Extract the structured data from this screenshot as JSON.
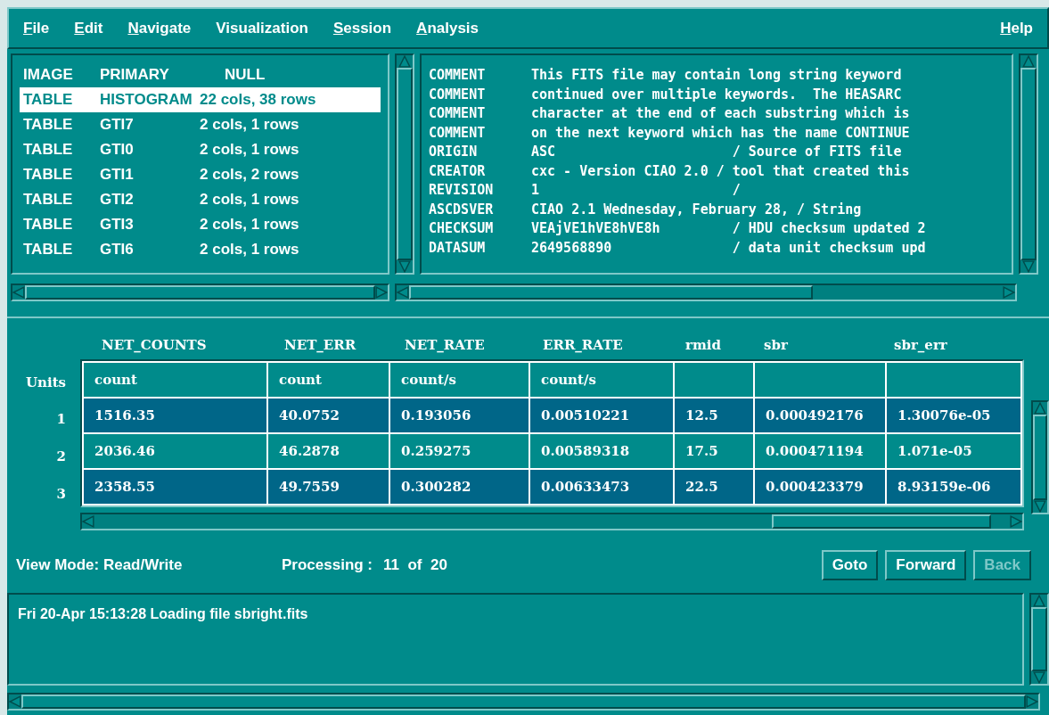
{
  "menu": [
    {
      "label": "File",
      "underline_first": true
    },
    {
      "label": "Edit",
      "underline_first": true
    },
    {
      "label": "Navigate",
      "underline_first": true
    },
    {
      "label": "Visualization",
      "underline_first": false
    },
    {
      "label": "Session",
      "underline_first": true
    },
    {
      "label": "Analysis",
      "underline_first": true
    }
  ],
  "help_menu": {
    "label": "Help",
    "underline_first": true
  },
  "hdu_list": [
    {
      "type": "IMAGE",
      "name": "PRIMARY",
      "info": "NULL",
      "selected": false
    },
    {
      "type": "TABLE",
      "name": "HISTOGRAM",
      "info": "22 cols, 38 rows",
      "selected": true
    },
    {
      "type": "TABLE",
      "name": "GTI7",
      "info": "2 cols, 1 rows",
      "selected": false
    },
    {
      "type": "TABLE",
      "name": "GTI0",
      "info": "2 cols, 1 rows",
      "selected": false
    },
    {
      "type": "TABLE",
      "name": "GTI1",
      "info": "2 cols, 2 rows",
      "selected": false
    },
    {
      "type": "TABLE",
      "name": "GTI2",
      "info": "2 cols, 1 rows",
      "selected": false
    },
    {
      "type": "TABLE",
      "name": "GTI3",
      "info": "2 cols, 1 rows",
      "selected": false
    },
    {
      "type": "TABLE",
      "name": "GTI6",
      "info": "2 cols, 1 rows",
      "selected": false
    }
  ],
  "header_lines": [
    {
      "keyword": "COMMENT",
      "value": "This FITS file may contain long string keyword"
    },
    {
      "keyword": "COMMENT",
      "value": "continued over multiple keywords.  The HEASARC"
    },
    {
      "keyword": "COMMENT",
      "value": "character at the end of each substring which is"
    },
    {
      "keyword": "COMMENT",
      "value": "on the next keyword which has the name CONTINUE"
    },
    {
      "keyword": "ORIGIN",
      "value": "ASC                      / Source of FITS file"
    },
    {
      "keyword": "CREATOR",
      "value": "cxc - Version CIAO 2.0 / tool that created this"
    },
    {
      "keyword": "REVISION",
      "value": "1                        /"
    },
    {
      "keyword": "ASCDSVER",
      "value": "CIAO 2.1 Wednesday, February 28, / String"
    },
    {
      "keyword": "CHECKSUM",
      "value": "VEAjVE1hVE8hVE8h         / HDU checksum updated 2"
    },
    {
      "keyword": "DATASUM",
      "value": "2649568890               / data unit checksum upd"
    }
  ],
  "table": {
    "columns": [
      "NET_COUNTS",
      "NET_ERR",
      "NET_RATE",
      "ERR_RATE",
      "rmid",
      "sbr",
      "sbr_err"
    ],
    "units_label": "Units",
    "units": [
      "count",
      "count",
      "count/s",
      "count/s"
    ],
    "rows": [
      {
        "index": "1",
        "selected": true,
        "cells": [
          "1516.35",
          "40.0752",
          "0.193056",
          "0.00510221",
          "12.5",
          "0.000492176",
          "1.30076e-05"
        ]
      },
      {
        "index": "2",
        "selected": false,
        "cells": [
          "2036.46",
          "46.2878",
          "0.259275",
          "0.00589318",
          "17.5",
          "0.000471194",
          "1.071e-05"
        ]
      },
      {
        "index": "3",
        "selected": true,
        "cells": [
          "2358.55",
          "49.7559",
          "0.300282",
          "0.00633473",
          "22.5",
          "0.000423379",
          "8.93159e-06"
        ]
      }
    ]
  },
  "status": {
    "view_mode": "View Mode: Read/Write",
    "processing_label": "Processing :",
    "processing_value": "11  of  20"
  },
  "buttons": [
    {
      "label": "Goto",
      "disabled": false
    },
    {
      "label": "Forward",
      "disabled": false
    },
    {
      "label": "Back",
      "disabled": true
    }
  ],
  "log": [
    "Fri 20-Apr 15:13:28 Loading file sbright.fits"
  ]
}
